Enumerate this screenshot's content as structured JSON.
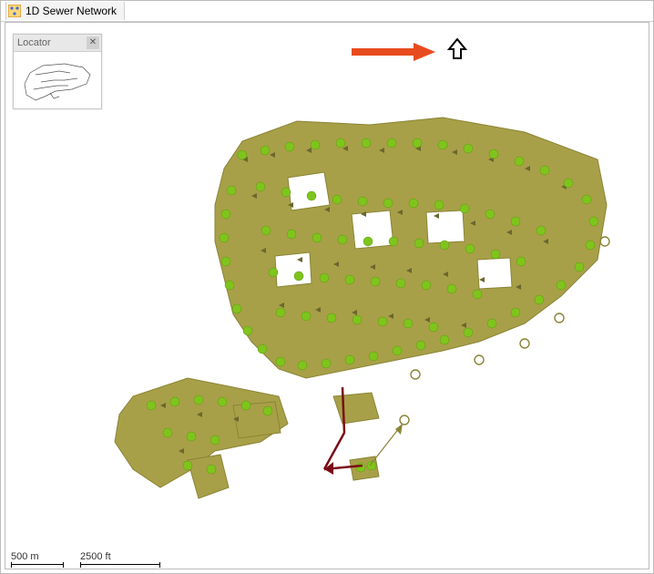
{
  "window": {
    "title": "1D Sewer Network"
  },
  "locator": {
    "title": "Locator"
  },
  "annotation": {
    "arrow_color": "#e84b1e",
    "north_arrow": "north"
  },
  "map": {
    "parcel_fill": "#a8a048",
    "parcel_stroke": "#8a8436",
    "node_color": "#7fc41c",
    "flow_arrow_color": "#6a672e",
    "highlight_line": "#7a0b16"
  },
  "scale_bars": [
    {
      "label": "500 m"
    },
    {
      "label": "2500 ft"
    }
  ]
}
